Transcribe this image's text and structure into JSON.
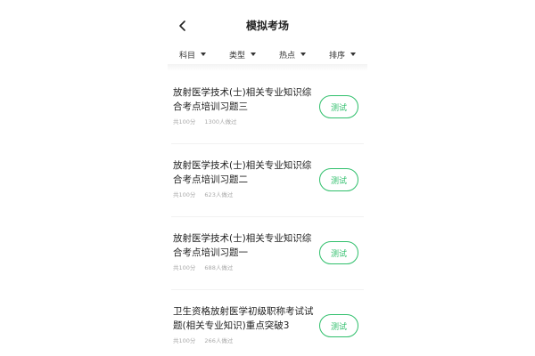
{
  "status": {
    "battery_color": "#2fbf6b"
  },
  "header": {
    "title": "模拟考场",
    "back_icon": "chevron-left-icon"
  },
  "filters": [
    {
      "label": "科目"
    },
    {
      "label": "类型"
    },
    {
      "label": "热点"
    },
    {
      "label": "排序"
    }
  ],
  "exams": [
    {
      "title": "放射医学技术(士)相关专业知识综合考点培训习题三",
      "score": "共100分",
      "count": "1300人做过",
      "button": "测试"
    },
    {
      "title": "放射医学技术(士)相关专业知识综合考点培训习题二",
      "score": "共100分",
      "count": "623人做过",
      "button": "测试"
    },
    {
      "title": "放射医学技术(士)相关专业知识综合考点培训习题一",
      "score": "共100分",
      "count": "688人做过",
      "button": "测试"
    },
    {
      "title": "卫生资格放射医学初级职称考试试题(相关专业知识)重点突破3",
      "score": "共100分",
      "count": "266人做过",
      "button": "测试"
    }
  ],
  "colors": {
    "accent": "#2fbf6b"
  }
}
